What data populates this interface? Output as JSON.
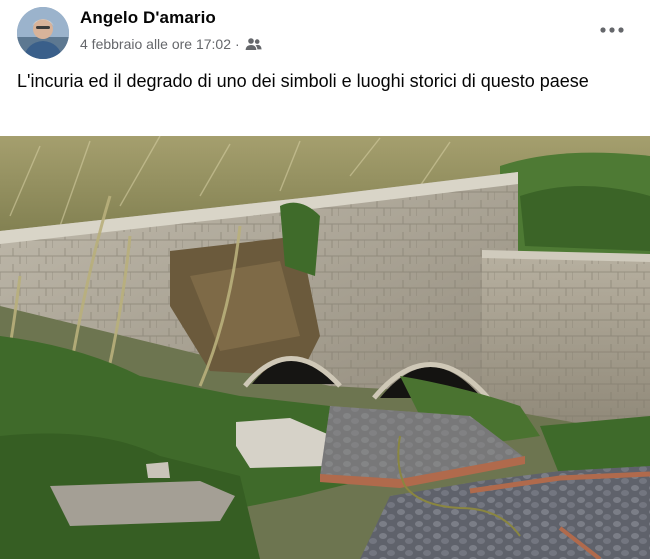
{
  "post": {
    "author": "Angelo D'amario",
    "date": "4 febbraio alle ore 17:02",
    "separator": "·",
    "audience_icon": "friends-icon",
    "more_icon": "more-options-icon",
    "text": "L'incuria ed il degrado di uno dei simboli e luoghi storici di questo paese"
  },
  "photo": {
    "subject": "overgrown old stone arched wall with two culvert openings, broken stone slabs, cobbled path",
    "colors": {
      "sky_vegetation": "#8f8a5c",
      "stone_wall": "#a9a394",
      "grass": "#3f6a2a",
      "paving": "#6a6c73",
      "brick_edge": "#b06a4c"
    }
  }
}
